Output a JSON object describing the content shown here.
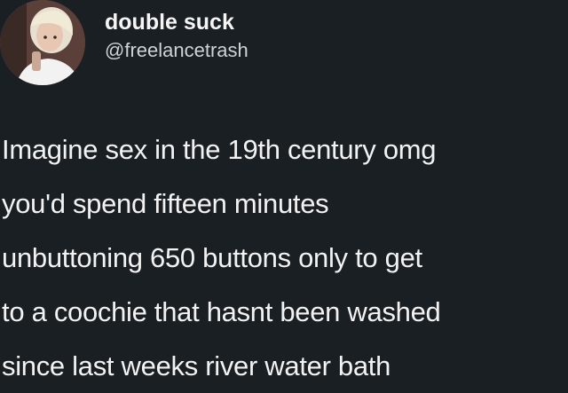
{
  "tweet": {
    "author": {
      "display_name": "double suck",
      "handle": "@freelancetrash",
      "avatar": "profile-photo"
    },
    "text_lines": [
      "Imagine sex in the 19th century omg",
      "you'd spend fifteen minutes",
      "unbuttoning 650 buttons only to get",
      "to a coochie that hasnt been washed",
      "since last weeks river water bath"
    ]
  },
  "colors": {
    "background": "#1a1f24",
    "text": "#f2f2f2",
    "handle": "#cfd3d6"
  }
}
